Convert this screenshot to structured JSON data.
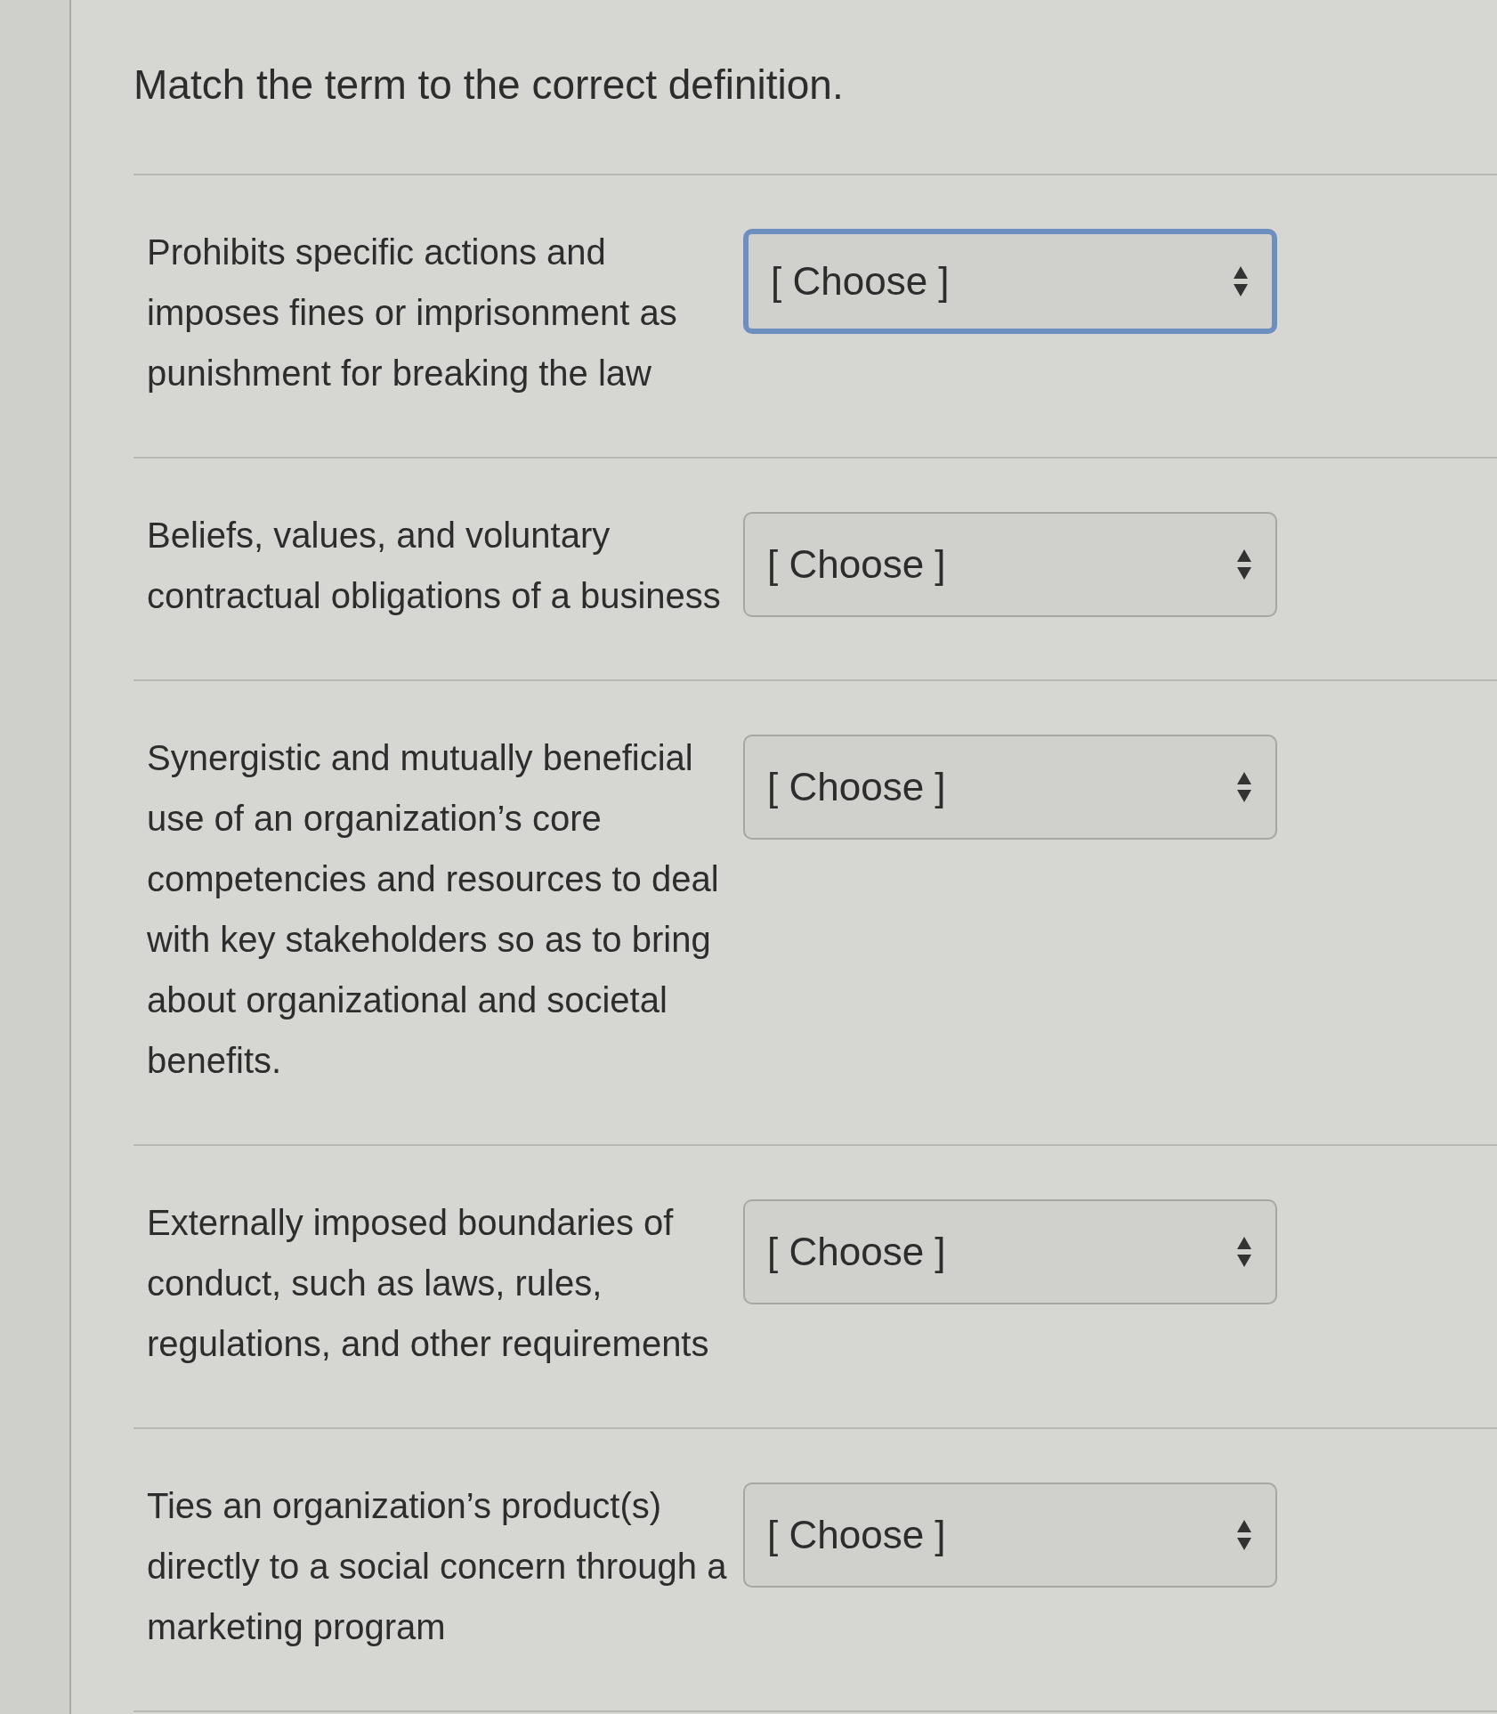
{
  "question": {
    "prompt": "Match the term to the correct definition."
  },
  "rows": [
    {
      "definition": "Prohibits specific actions and imposes fines or imprisonment as punishment for breaking the law",
      "choice": "[ Choose ]",
      "focused": true
    },
    {
      "definition": "Beliefs, values, and voluntary contractual obligations of a business",
      "choice": "[ Choose ]",
      "focused": false
    },
    {
      "definition": "Synergistic and mutually beneficial use of an organization’s core competencies and resources to deal with key stakeholders so as to bring about organizational and societal benefits.",
      "choice": "[ Choose ]",
      "focused": false
    },
    {
      "definition": "Externally imposed boundaries of conduct, such as laws, rules, regulations, and other requirements",
      "choice": "[ Choose ]",
      "focused": false
    },
    {
      "definition": "Ties an organization’s product(s) directly to a social concern through a marketing program",
      "choice": "[ Choose ]",
      "focused": false
    }
  ]
}
